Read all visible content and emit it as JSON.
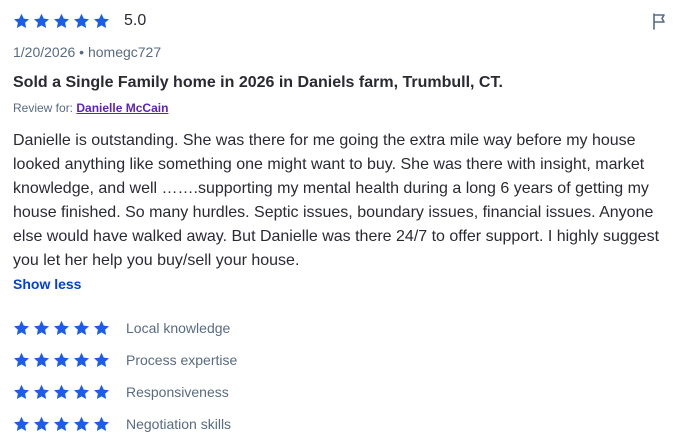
{
  "overall": {
    "rating": 5,
    "rating_text": "5.0"
  },
  "meta": "1/20/2026 • homegc727",
  "title": "Sold a Single Family home in 2026 in Daniels farm, Trumbull, CT.",
  "review_for": {
    "label": "Review for:",
    "agent": "Danielle McCain"
  },
  "body": "Danielle is outstanding. She was there for me going the extra mile way before my house looked anything like something one might want to buy. She was there with insight, market knowledge, and well …….supporting my mental health during a long 6 years of getting my house finished. So many hurdles. Septic issues, boundary issues, financial issues. Anyone else would have walked away. But Danielle was there 24/7 to offer support. I highly suggest you let her help you buy/sell your house.",
  "show_less": "Show less",
  "criteria": [
    {
      "label": "Local knowledge",
      "rating": 5
    },
    {
      "label": "Process expertise",
      "rating": 5
    },
    {
      "label": "Responsiveness",
      "rating": 5
    },
    {
      "label": "Negotiation skills",
      "rating": 5
    }
  ],
  "colors": {
    "star": "#1b5ce8",
    "link": "#0041d9",
    "agent_link": "#5c24b4",
    "text": "#2a2a33",
    "muted": "#596b82"
  },
  "icons": {
    "star": "star-icon",
    "flag": "flag-icon"
  }
}
